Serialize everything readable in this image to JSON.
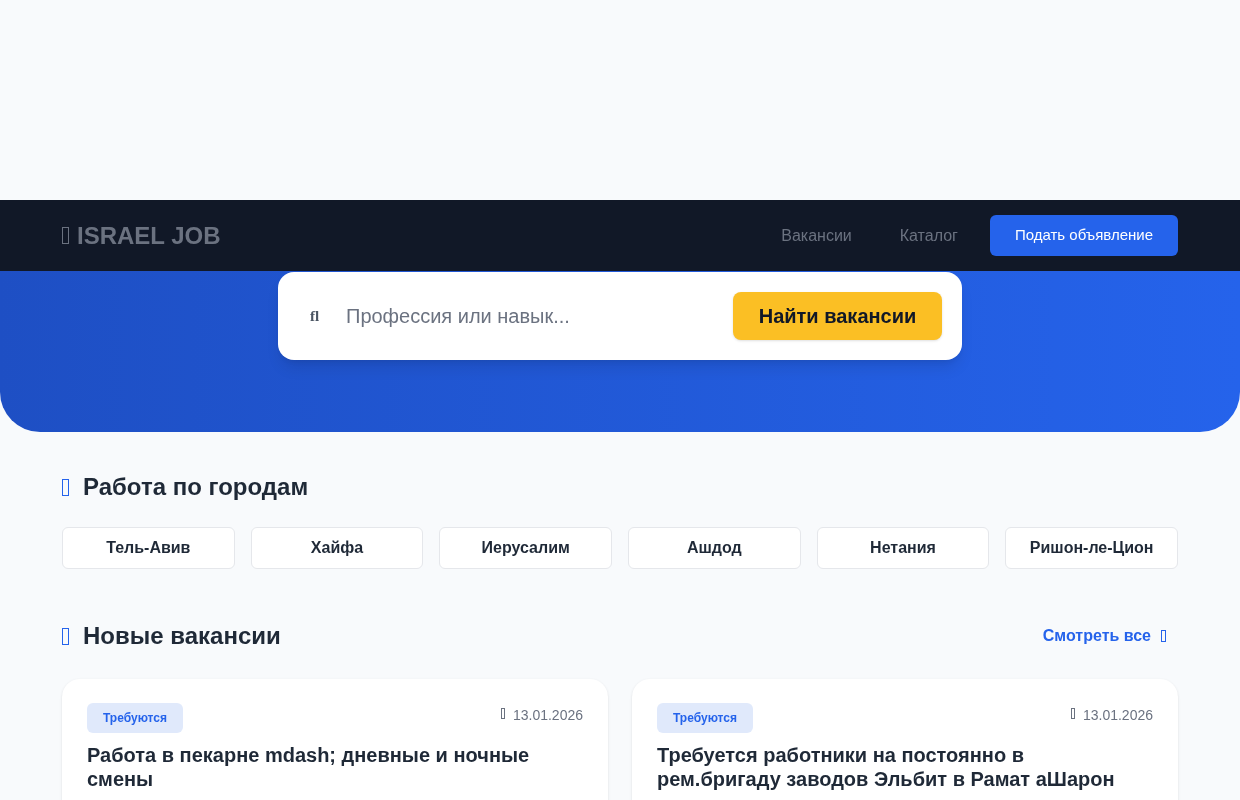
{
  "header": {
    "logo": "ISRAEL JOB",
    "nav": [
      {
        "label": "Вакансии",
        "kind": "link"
      },
      {
        "label": "Каталог",
        "kind": "link"
      },
      {
        "label": "Подать объявление",
        "kind": "button"
      }
    ]
  },
  "search": {
    "icon_glyph": "fl",
    "placeholder": "Профессия или навык...",
    "button": "Найти вакансии"
  },
  "cities": {
    "title": "Работа по городам",
    "items": [
      "Тель-Авив",
      "Хайфа",
      "Иерусалим",
      "Ашдод",
      "Нетания",
      "Ришон-ле-Цион"
    ]
  },
  "jobs": {
    "title": "Новые вакансии",
    "see_all": "Смотреть все",
    "cards": [
      {
        "tag": "Требуются",
        "date": "13.01.2026",
        "title": "Работа в пекарне mdash; дневные и ночные смены"
      },
      {
        "tag": "Требуются",
        "date": "13.01.2026",
        "title": "Требуется работники на постоянно в рем.бригаду заводов Эльбит в Рамат аШарон"
      }
    ]
  }
}
